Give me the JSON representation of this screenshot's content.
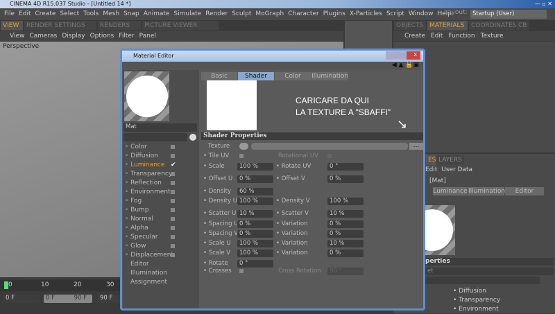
{
  "app": {
    "title": "CINEMA 4D R15.037 Studio - [Untitled 14 *]"
  },
  "menu": [
    "File",
    "Edit",
    "Create",
    "Select",
    "Tools",
    "Mesh",
    "Snap",
    "Animate",
    "Simulate",
    "Render",
    "Sculpt",
    "MoGraph",
    "Character",
    "Plugins",
    "X-Particles",
    "Script",
    "Window",
    "Help"
  ],
  "layout": {
    "label": "Layout:",
    "value": "Startup (User)"
  },
  "view_tabs": [
    "VIEW",
    "RENDER SETTINGS",
    "RENDERS",
    "PICTURE VIEWER"
  ],
  "view_menu": [
    "View",
    "Cameras",
    "Display",
    "Options",
    "Filter",
    "Panel"
  ],
  "viewport_label": "Perspective",
  "right_tabs": [
    "OBJECTS",
    "MATERIALS",
    "COORDINATES",
    "CB"
  ],
  "right_menu": [
    "Create",
    "Edit",
    "Function",
    "Texture"
  ],
  "timeline": {
    "ticks": [
      "0",
      "10",
      "20",
      "30"
    ],
    "current": "0 F",
    "range_start": "0 F",
    "range_end": "90 F",
    "end": "90 F"
  },
  "editor": {
    "title": "Material Editor",
    "material_name": "Mat",
    "channels": [
      {
        "label": "Color",
        "checked": false
      },
      {
        "label": "Diffusion",
        "checked": false
      },
      {
        "label": "Luminance",
        "checked": true
      },
      {
        "label": "Transparency",
        "checked": false
      },
      {
        "label": "Reflection",
        "checked": false
      },
      {
        "label": "Environment",
        "checked": false
      },
      {
        "label": "Fog",
        "checked": false
      },
      {
        "label": "Bump",
        "checked": false
      },
      {
        "label": "Normal",
        "checked": false
      },
      {
        "label": "Alpha",
        "checked": false
      },
      {
        "label": "Specular",
        "checked": false
      },
      {
        "label": "Glow",
        "checked": false
      },
      {
        "label": "Displacement",
        "checked": false
      }
    ],
    "extra": [
      "Editor",
      "Illumination",
      "Assignment"
    ],
    "tabs": [
      "Basic",
      "Shader",
      "Color",
      "Illumination"
    ],
    "active_tab": "Shader",
    "annotation": [
      "CARICARE DA QUI",
      "LA TEXTURE A \"SBAFFI\""
    ],
    "section": "Shader Properties",
    "texture_label": "Texture",
    "browse": "...",
    "tile_uv": "Tile UV",
    "rotational_uv": "Rotational UV",
    "rows": [
      {
        "l": "Scale",
        "v": "100 %",
        "r": "Rotate UV",
        "rv": "0 °"
      },
      {
        "l": "Offset U",
        "v": "0 %",
        "r": "Offset V",
        "rv": "0 %"
      },
      {
        "l": "Density",
        "v": "60 %"
      },
      {
        "l": "Density U",
        "v": "100 %",
        "r": "Density V",
        "rv": "100 %"
      },
      {
        "l": "Scatter U",
        "v": "10 %",
        "r": "Scatter V",
        "rv": "10 %"
      },
      {
        "l": "Spacing U",
        "v": "0 %",
        "r": "Variation",
        "rv": "0 %"
      },
      {
        "l": "Spacing V",
        "v": "0 %",
        "r": "Variation",
        "rv": "0 %"
      },
      {
        "l": "Scale U",
        "v": "100 %",
        "r": "Variation",
        "rv": "10 %"
      },
      {
        "l": "Scale V",
        "v": "100 %",
        "r": "Variation",
        "rv": "0 %"
      },
      {
        "l": "Rotate",
        "v": "0 °"
      }
    ],
    "crosses": "Crosses",
    "cross_rotation": "Cross Rotation",
    "cross_rotation_value": "90 °"
  },
  "attr": {
    "tabs": [
      "ES",
      "LAYERS"
    ],
    "menu": [
      "Edit",
      "User Data"
    ],
    "name": "[Mat]",
    "tabs2": [
      "Luminance",
      "Illumination",
      "Editor"
    ],
    "section": "perties",
    "field": "et",
    "list": [
      "Diffusion",
      "Transparency",
      "Environment"
    ]
  }
}
